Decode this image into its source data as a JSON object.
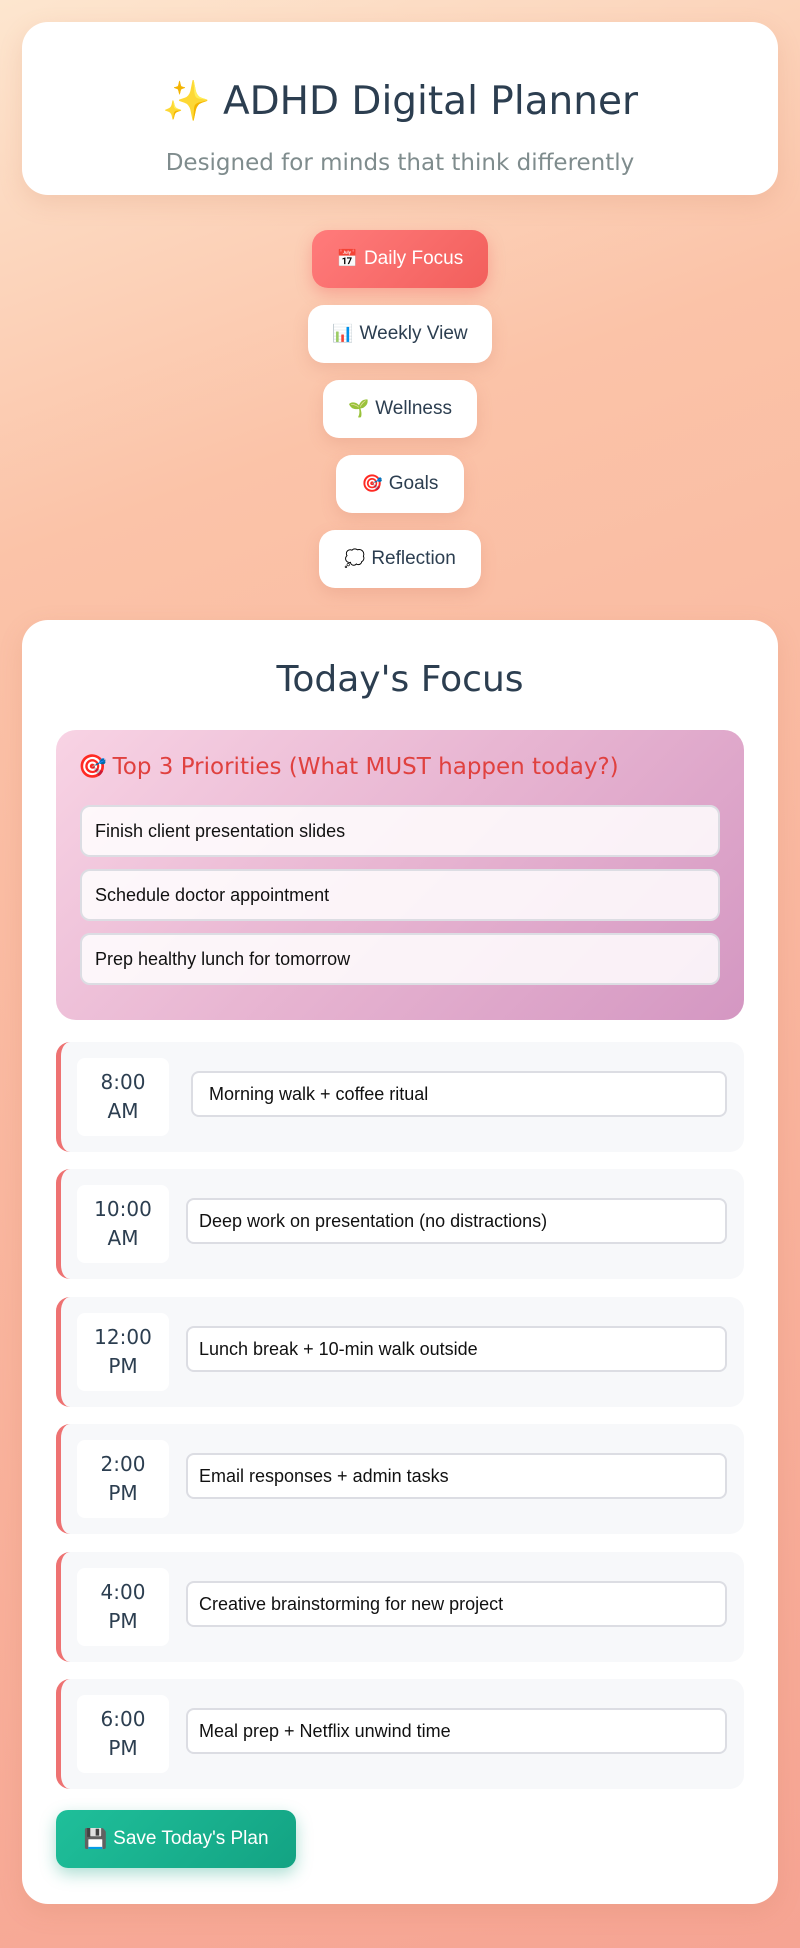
{
  "header": {
    "title_icon": "✨",
    "title": "ADHD Digital Planner",
    "subtitle": "Designed for minds that think differently"
  },
  "nav": {
    "items": [
      {
        "icon": "📅",
        "icon_name": "calendar-icon",
        "label": "Daily Focus",
        "active": true
      },
      {
        "icon": "📊",
        "icon_name": "bar-chart-icon",
        "label": "Weekly View",
        "active": false
      },
      {
        "icon": "🌱",
        "icon_name": "seedling-icon",
        "label": "Wellness",
        "active": false
      },
      {
        "icon": "🎯",
        "icon_name": "target-icon",
        "label": "Goals",
        "active": false
      },
      {
        "icon": "💭",
        "icon_name": "thought-bubble-icon",
        "label": "Reflection",
        "active": false
      }
    ]
  },
  "main": {
    "section_title": "Today's Focus",
    "priorities": {
      "icon": "🎯",
      "title": "Top 3 Priorities (What MUST happen today?)",
      "items": [
        "Finish client presentation slides",
        "Schedule doctor appointment",
        "Prep healthy lunch for tomorrow"
      ]
    },
    "schedule": [
      {
        "time_line1": "8:00",
        "time_line2": "AM",
        "task": "Morning walk + coffee ritual"
      },
      {
        "time_line1": "10:00",
        "time_line2": "AM",
        "task": "Deep work on presentation (no distractions)"
      },
      {
        "time_line1": "12:00",
        "time_line2": "PM",
        "task": "Lunch break + 10-min walk outside"
      },
      {
        "time_line1": "2:00",
        "time_line2": "PM",
        "task": "Email responses + admin tasks"
      },
      {
        "time_line1": "4:00",
        "time_line2": "PM",
        "task": "Creative brainstorming for new project"
      },
      {
        "time_line1": "6:00",
        "time_line2": "PM",
        "task": "Meal prep + Netflix unwind time"
      }
    ],
    "save_button": {
      "icon": "💾",
      "label": "Save Today's Plan"
    }
  },
  "colors": {
    "accent_red": "#f25f5c",
    "priority_title": "#e0413f",
    "save_green": "#13a383",
    "text_dark": "#2c3e50"
  }
}
